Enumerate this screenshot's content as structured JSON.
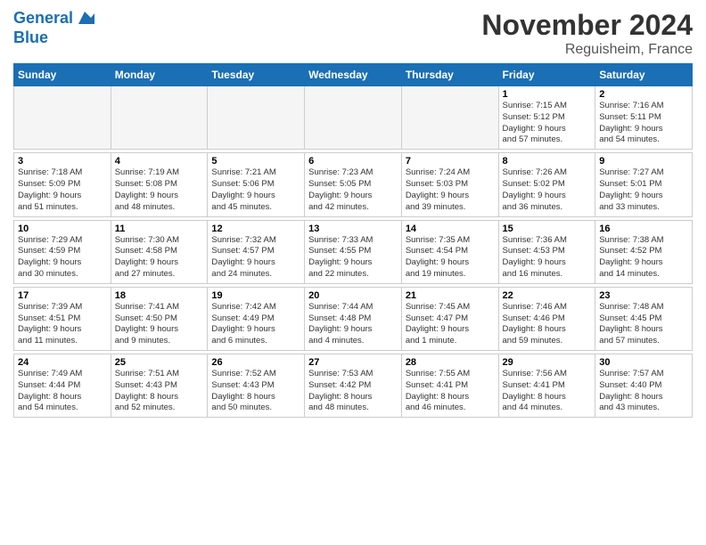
{
  "header": {
    "logo_line1": "General",
    "logo_line2": "Blue",
    "title": "November 2024",
    "subtitle": "Reguisheim, France"
  },
  "days_of_week": [
    "Sunday",
    "Monday",
    "Tuesday",
    "Wednesday",
    "Thursday",
    "Friday",
    "Saturday"
  ],
  "weeks": [
    {
      "days": [
        {
          "num": "",
          "info": "",
          "empty": true
        },
        {
          "num": "",
          "info": "",
          "empty": true
        },
        {
          "num": "",
          "info": "",
          "empty": true
        },
        {
          "num": "",
          "info": "",
          "empty": true
        },
        {
          "num": "",
          "info": "",
          "empty": true
        },
        {
          "num": "1",
          "info": "Sunrise: 7:15 AM\nSunset: 5:12 PM\nDaylight: 9 hours\nand 57 minutes.",
          "empty": false
        },
        {
          "num": "2",
          "info": "Sunrise: 7:16 AM\nSunset: 5:11 PM\nDaylight: 9 hours\nand 54 minutes.",
          "empty": false
        }
      ]
    },
    {
      "days": [
        {
          "num": "3",
          "info": "Sunrise: 7:18 AM\nSunset: 5:09 PM\nDaylight: 9 hours\nand 51 minutes.",
          "empty": false
        },
        {
          "num": "4",
          "info": "Sunrise: 7:19 AM\nSunset: 5:08 PM\nDaylight: 9 hours\nand 48 minutes.",
          "empty": false
        },
        {
          "num": "5",
          "info": "Sunrise: 7:21 AM\nSunset: 5:06 PM\nDaylight: 9 hours\nand 45 minutes.",
          "empty": false
        },
        {
          "num": "6",
          "info": "Sunrise: 7:23 AM\nSunset: 5:05 PM\nDaylight: 9 hours\nand 42 minutes.",
          "empty": false
        },
        {
          "num": "7",
          "info": "Sunrise: 7:24 AM\nSunset: 5:03 PM\nDaylight: 9 hours\nand 39 minutes.",
          "empty": false
        },
        {
          "num": "8",
          "info": "Sunrise: 7:26 AM\nSunset: 5:02 PM\nDaylight: 9 hours\nand 36 minutes.",
          "empty": false
        },
        {
          "num": "9",
          "info": "Sunrise: 7:27 AM\nSunset: 5:01 PM\nDaylight: 9 hours\nand 33 minutes.",
          "empty": false
        }
      ]
    },
    {
      "days": [
        {
          "num": "10",
          "info": "Sunrise: 7:29 AM\nSunset: 4:59 PM\nDaylight: 9 hours\nand 30 minutes.",
          "empty": false
        },
        {
          "num": "11",
          "info": "Sunrise: 7:30 AM\nSunset: 4:58 PM\nDaylight: 9 hours\nand 27 minutes.",
          "empty": false
        },
        {
          "num": "12",
          "info": "Sunrise: 7:32 AM\nSunset: 4:57 PM\nDaylight: 9 hours\nand 24 minutes.",
          "empty": false
        },
        {
          "num": "13",
          "info": "Sunrise: 7:33 AM\nSunset: 4:55 PM\nDaylight: 9 hours\nand 22 minutes.",
          "empty": false
        },
        {
          "num": "14",
          "info": "Sunrise: 7:35 AM\nSunset: 4:54 PM\nDaylight: 9 hours\nand 19 minutes.",
          "empty": false
        },
        {
          "num": "15",
          "info": "Sunrise: 7:36 AM\nSunset: 4:53 PM\nDaylight: 9 hours\nand 16 minutes.",
          "empty": false
        },
        {
          "num": "16",
          "info": "Sunrise: 7:38 AM\nSunset: 4:52 PM\nDaylight: 9 hours\nand 14 minutes.",
          "empty": false
        }
      ]
    },
    {
      "days": [
        {
          "num": "17",
          "info": "Sunrise: 7:39 AM\nSunset: 4:51 PM\nDaylight: 9 hours\nand 11 minutes.",
          "empty": false
        },
        {
          "num": "18",
          "info": "Sunrise: 7:41 AM\nSunset: 4:50 PM\nDaylight: 9 hours\nand 9 minutes.",
          "empty": false
        },
        {
          "num": "19",
          "info": "Sunrise: 7:42 AM\nSunset: 4:49 PM\nDaylight: 9 hours\nand 6 minutes.",
          "empty": false
        },
        {
          "num": "20",
          "info": "Sunrise: 7:44 AM\nSunset: 4:48 PM\nDaylight: 9 hours\nand 4 minutes.",
          "empty": false
        },
        {
          "num": "21",
          "info": "Sunrise: 7:45 AM\nSunset: 4:47 PM\nDaylight: 9 hours\nand 1 minute.",
          "empty": false
        },
        {
          "num": "22",
          "info": "Sunrise: 7:46 AM\nSunset: 4:46 PM\nDaylight: 8 hours\nand 59 minutes.",
          "empty": false
        },
        {
          "num": "23",
          "info": "Sunrise: 7:48 AM\nSunset: 4:45 PM\nDaylight: 8 hours\nand 57 minutes.",
          "empty": false
        }
      ]
    },
    {
      "days": [
        {
          "num": "24",
          "info": "Sunrise: 7:49 AM\nSunset: 4:44 PM\nDaylight: 8 hours\nand 54 minutes.",
          "empty": false
        },
        {
          "num": "25",
          "info": "Sunrise: 7:51 AM\nSunset: 4:43 PM\nDaylight: 8 hours\nand 52 minutes.",
          "empty": false
        },
        {
          "num": "26",
          "info": "Sunrise: 7:52 AM\nSunset: 4:43 PM\nDaylight: 8 hours\nand 50 minutes.",
          "empty": false
        },
        {
          "num": "27",
          "info": "Sunrise: 7:53 AM\nSunset: 4:42 PM\nDaylight: 8 hours\nand 48 minutes.",
          "empty": false
        },
        {
          "num": "28",
          "info": "Sunrise: 7:55 AM\nSunset: 4:41 PM\nDaylight: 8 hours\nand 46 minutes.",
          "empty": false
        },
        {
          "num": "29",
          "info": "Sunrise: 7:56 AM\nSunset: 4:41 PM\nDaylight: 8 hours\nand 44 minutes.",
          "empty": false
        },
        {
          "num": "30",
          "info": "Sunrise: 7:57 AM\nSunset: 4:40 PM\nDaylight: 8 hours\nand 43 minutes.",
          "empty": false
        }
      ]
    }
  ]
}
